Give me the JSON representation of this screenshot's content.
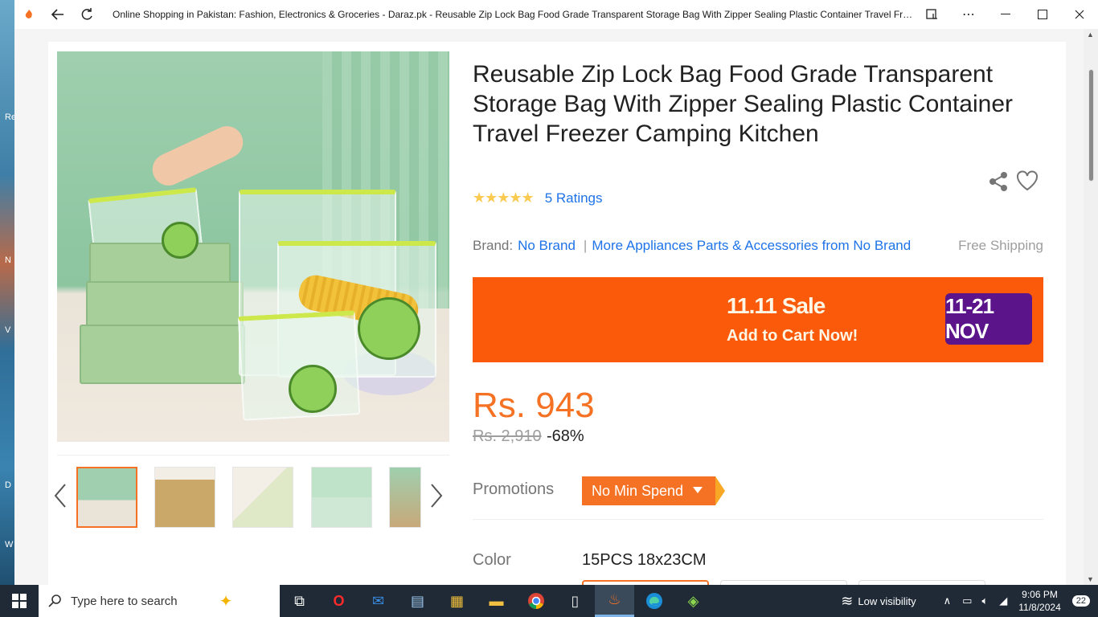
{
  "browser": {
    "title": "Online Shopping in Pakistan: Fashion, Electronics & Groceries - Daraz.pk - Reusable Zip Lock Bag Food Grade Transparent Storage Bag With Zipper Sealing Plastic Container Travel Freezer...",
    "back_icon": "arrow-left",
    "refresh_icon": "refresh"
  },
  "desktop": {
    "labels": [
      "Re",
      "N",
      "V",
      "D",
      "W"
    ]
  },
  "product": {
    "title": "Reusable Zip Lock Bag Food Grade Transparent Storage Bag With Zipper Sealing Plastic Container Travel Freezer Camping Kitchen",
    "stars": "★★★★★",
    "rating_count": "5 Ratings",
    "brand_label": "Brand:",
    "brand_name": "No Brand",
    "brand_sep": "|",
    "more_link": "More Appliances Parts & Accessories from No Brand",
    "free_shipping": "Free Shipping",
    "price": "Rs. 943",
    "old_price": "Rs. 2,910",
    "discount": "-68%",
    "promotions_label": "Promotions",
    "promo_tag": "No Min Spend",
    "color_label": "Color",
    "color_value": "15PCS 18x23CM"
  },
  "banner": {
    "sale_text": "11.11 Sale",
    "cta_text": "Add to Cart Now!",
    "date_text": "11-21 NOV"
  },
  "taskbar": {
    "search_placeholder": "Type here to search",
    "weather": "Low visibility",
    "time": "9:06 PM",
    "date": "11/8/2024",
    "notifications": "22"
  }
}
